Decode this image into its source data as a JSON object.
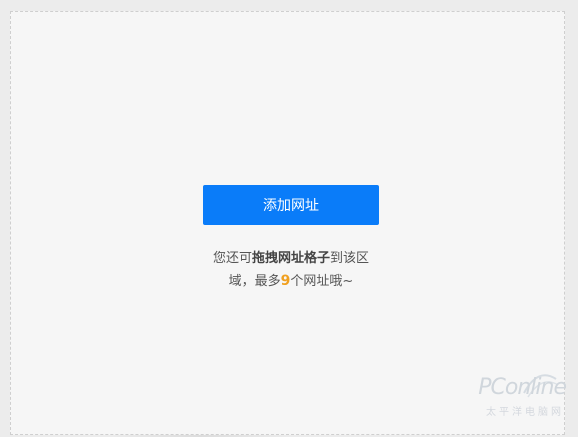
{
  "add_button": {
    "label": "添加网址"
  },
  "hint": {
    "line1_prefix": "您还可",
    "line1_strong": "拖拽网址格子",
    "line1_suffix": "到该区",
    "line2_prefix": "域，最多",
    "count": "9",
    "line2_suffix": "个网址哦~"
  },
  "watermark": {
    "logo": "PConline",
    "subtitle": "太平洋电脑网"
  },
  "colors": {
    "accent": "#0a7cf9",
    "count_highlight": "#f0a020"
  }
}
